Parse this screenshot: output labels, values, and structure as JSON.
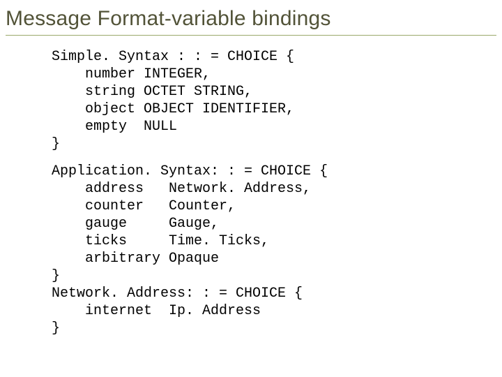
{
  "title": "Message Format-variable bindings",
  "code_block_1": "Simple. Syntax : : = CHOICE {\n    number INTEGER,\n    string OCTET STRING,\n    object OBJECT IDENTIFIER,\n    empty  NULL\n}",
  "code_block_2": "Application. Syntax: : = CHOICE {\n    address   Network. Address,\n    counter   Counter,\n    gauge     Gauge,\n    ticks     Time. Ticks,\n    arbitrary Opaque\n}\nNetwork. Address: : = CHOICE {\n    internet  Ip. Address\n}"
}
